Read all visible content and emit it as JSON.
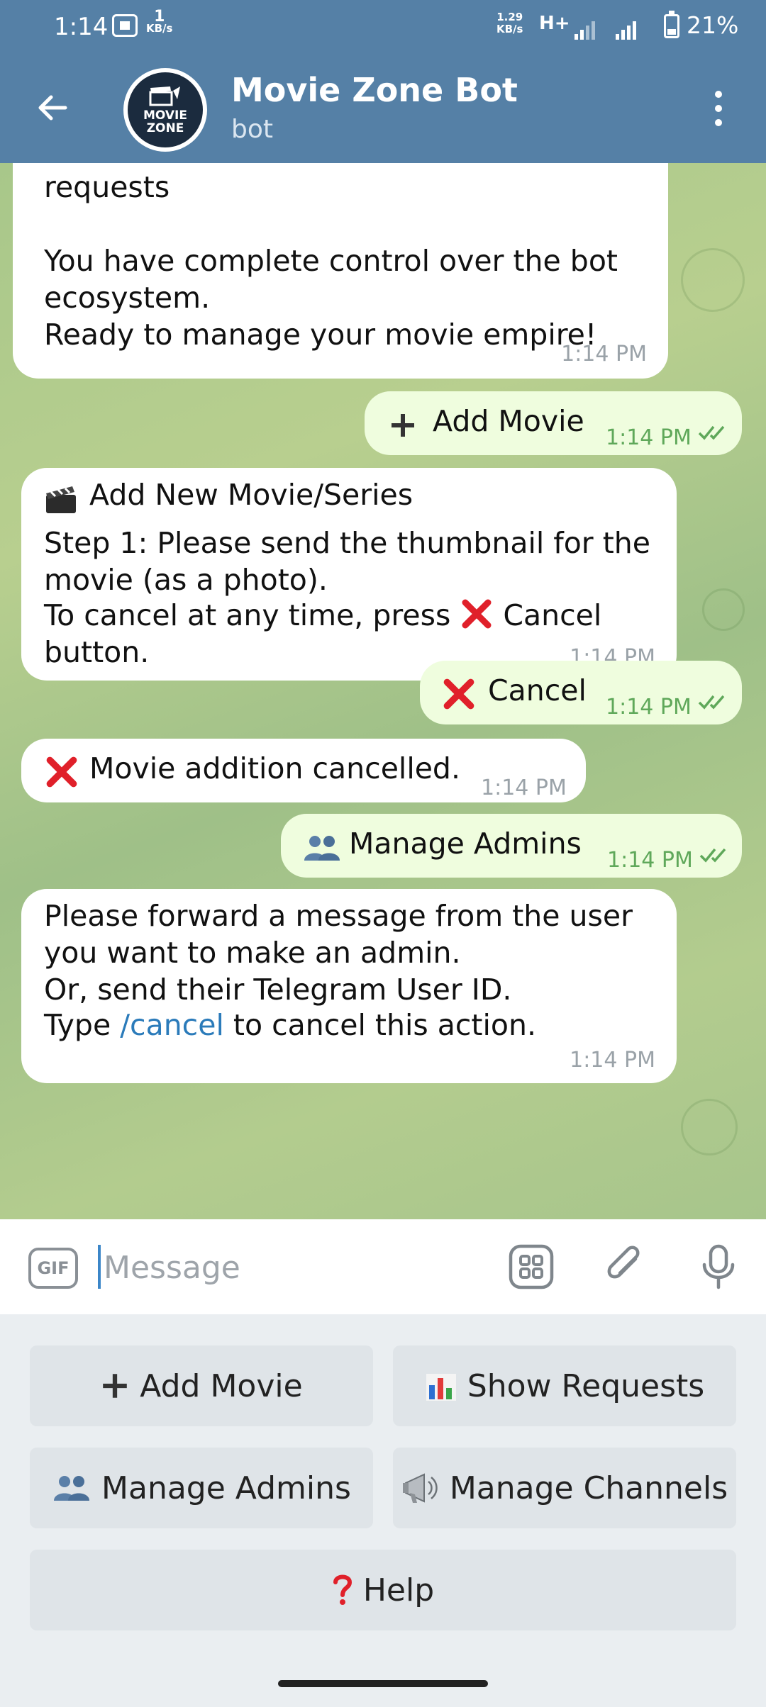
{
  "status_bar": {
    "time": "1:14",
    "net_speed_left_value": "1",
    "net_speed_left_unit": "KB/s",
    "net_speed_right_value": "1.29",
    "net_speed_right_unit": "KB/s",
    "network_type": "H+",
    "battery": "21%"
  },
  "header": {
    "title": "Movie Zone Bot",
    "subtitle": "bot",
    "avatar_text_1": "MOVIE",
    "avatar_text_2": "ZONE"
  },
  "messages": [
    {
      "direction": "in",
      "text": "requests\n\nYou have complete control over the bot\necosystem.\nReady to manage your movie empire!",
      "time": "1:14 PM"
    },
    {
      "direction": "out",
      "icon": "plus-icon",
      "text": "Add Movie",
      "time": "1:14 PM",
      "status": "read"
    },
    {
      "direction": "in",
      "icon": "clapper-icon",
      "title": "Add New Movie/Series",
      "text": "Step 1: Please send the thumbnail for the\nmovie (as a photo).",
      "text2_pre": "To cancel at any time, press ",
      "text2_mid": "Cancel",
      "text2_post": "button.",
      "time": "1:14 PM"
    },
    {
      "direction": "out",
      "icon": "cross-mark-icon",
      "text": "Cancel",
      "time": "1:14 PM",
      "status": "read"
    },
    {
      "direction": "in",
      "icon": "cross-mark-icon",
      "text": "Movie addition cancelled.",
      "time": "1:14 PM"
    },
    {
      "direction": "out",
      "icon": "people-icon",
      "text": "Manage Admins",
      "time": "1:14 PM",
      "status": "read"
    },
    {
      "direction": "in",
      "text": "Please forward a message from the user\nyou want to make an admin.\nOr, send their Telegram User ID.",
      "text2_pre": "Type ",
      "link": "/cancel",
      "text2_post": " to cancel this action.",
      "time": "1:14 PM"
    }
  ],
  "input": {
    "gif_label": "GIF",
    "placeholder": "Message"
  },
  "keyboard": {
    "buttons": [
      {
        "icon": "plus-icon",
        "label": "Add Movie"
      },
      {
        "icon": "bar-chart-icon",
        "label": "Show Requests"
      },
      {
        "icon": "people-icon",
        "label": "Manage Admins"
      },
      {
        "icon": "megaphone-icon",
        "label": "Manage Channels"
      },
      {
        "icon": "question-mark-icon",
        "label": "Help"
      }
    ]
  },
  "colors": {
    "header": "#5580a6",
    "outgoing_bubble": "#effdde",
    "incoming_bubble": "#ffffff",
    "link": "#2b7bba",
    "read_checks": "#5fa85a",
    "cross_mark": "#e0202a"
  }
}
